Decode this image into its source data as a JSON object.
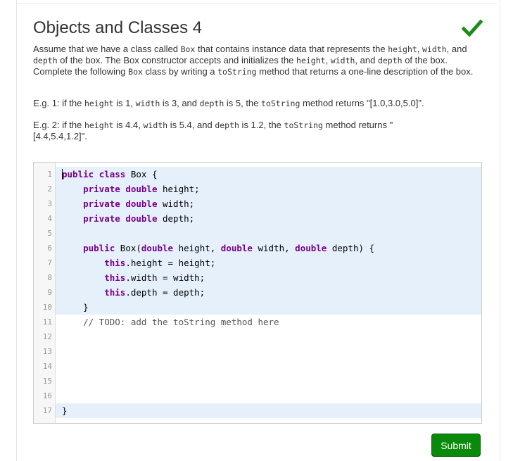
{
  "page": {
    "title": "Objects and Classes 4",
    "status_icon": "check-icon",
    "status_color": "#1e8b1e"
  },
  "description": {
    "p1": [
      {
        "t": "Assume that we have a class called "
      },
      {
        "c": "Box"
      },
      {
        "t": " that contains instance data that represents the "
      },
      {
        "c": "height"
      },
      {
        "t": ", "
      },
      {
        "c": "width"
      },
      {
        "t": ", and "
      },
      {
        "c": "depth"
      },
      {
        "t": " of the box. The Box constructor accepts and initializes the "
      },
      {
        "c": "height"
      },
      {
        "t": ", "
      },
      {
        "c": "width"
      },
      {
        "t": ", and "
      },
      {
        "c": "depth"
      },
      {
        "t": " of the box. Complete the following "
      },
      {
        "c": "Box"
      },
      {
        "t": " class by writing a "
      },
      {
        "c": "toString"
      },
      {
        "t": " method that returns a one-line description of the box."
      }
    ],
    "p2": [
      {
        "t": "E.g. 1: if the "
      },
      {
        "c": "height"
      },
      {
        "t": " is 1, "
      },
      {
        "c": "width"
      },
      {
        "t": " is 3, and "
      },
      {
        "c": "depth"
      },
      {
        "t": " is 5, the "
      },
      {
        "c": "toString"
      },
      {
        "t": " method returns \"[1.0,3.0,5.0]\"."
      }
    ],
    "p3": [
      {
        "t": "E.g. 2: if the "
      },
      {
        "c": "height"
      },
      {
        "t": " is 4.4, "
      },
      {
        "c": "width"
      },
      {
        "t": " is 5.4, and "
      },
      {
        "c": "depth"
      },
      {
        "t": " is 1.2, the "
      },
      {
        "c": "toString"
      },
      {
        "t": " method returns \" [4.4,5.4,1.2]\"."
      }
    ]
  },
  "editor": {
    "lines": [
      {
        "n": "1",
        "hl": true,
        "cursor": true,
        "parts": [
          {
            "k": "public"
          },
          {
            "t": " "
          },
          {
            "k": "class"
          },
          {
            "t": " Box {"
          }
        ]
      },
      {
        "n": "2",
        "hl": true,
        "parts": [
          {
            "t": "    "
          },
          {
            "k": "private"
          },
          {
            "t": " "
          },
          {
            "k": "double"
          },
          {
            "t": " height;"
          }
        ]
      },
      {
        "n": "3",
        "hl": true,
        "parts": [
          {
            "t": "    "
          },
          {
            "k": "private"
          },
          {
            "t": " "
          },
          {
            "k": "double"
          },
          {
            "t": " width;"
          }
        ]
      },
      {
        "n": "4",
        "hl": true,
        "parts": [
          {
            "t": "    "
          },
          {
            "k": "private"
          },
          {
            "t": " "
          },
          {
            "k": "double"
          },
          {
            "t": " depth;"
          }
        ]
      },
      {
        "n": "5",
        "hl": true,
        "parts": []
      },
      {
        "n": "6",
        "hl": true,
        "parts": [
          {
            "t": "    "
          },
          {
            "k": "public"
          },
          {
            "t": " Box("
          },
          {
            "k": "double"
          },
          {
            "t": " height, "
          },
          {
            "k": "double"
          },
          {
            "t": " width, "
          },
          {
            "k": "double"
          },
          {
            "t": " depth) {"
          }
        ]
      },
      {
        "n": "7",
        "hl": true,
        "parts": [
          {
            "t": "        "
          },
          {
            "k": "this"
          },
          {
            "t": ".height = height;"
          }
        ]
      },
      {
        "n": "8",
        "hl": true,
        "parts": [
          {
            "t": "        "
          },
          {
            "k": "this"
          },
          {
            "t": ".width = width;"
          }
        ]
      },
      {
        "n": "9",
        "hl": true,
        "parts": [
          {
            "t": "        "
          },
          {
            "k": "this"
          },
          {
            "t": ".depth = depth;"
          }
        ]
      },
      {
        "n": "10",
        "hl": true,
        "parts": [
          {
            "t": "    }"
          }
        ]
      },
      {
        "n": "11",
        "hl": false,
        "parts": [
          {
            "t": "    "
          },
          {
            "m": "// TODO: add the toString method here"
          }
        ]
      },
      {
        "n": "12",
        "hl": false,
        "parts": []
      },
      {
        "n": "13",
        "hl": false,
        "parts": []
      },
      {
        "n": "14",
        "hl": false,
        "parts": []
      },
      {
        "n": "15",
        "hl": false,
        "parts": []
      },
      {
        "n": "16",
        "hl": false,
        "parts": []
      },
      {
        "n": "17",
        "hl": true,
        "parts": [
          {
            "t": "}"
          }
        ]
      }
    ]
  },
  "actions": {
    "submit_label": "Submit",
    "submit_color": "#0a8a0a"
  }
}
